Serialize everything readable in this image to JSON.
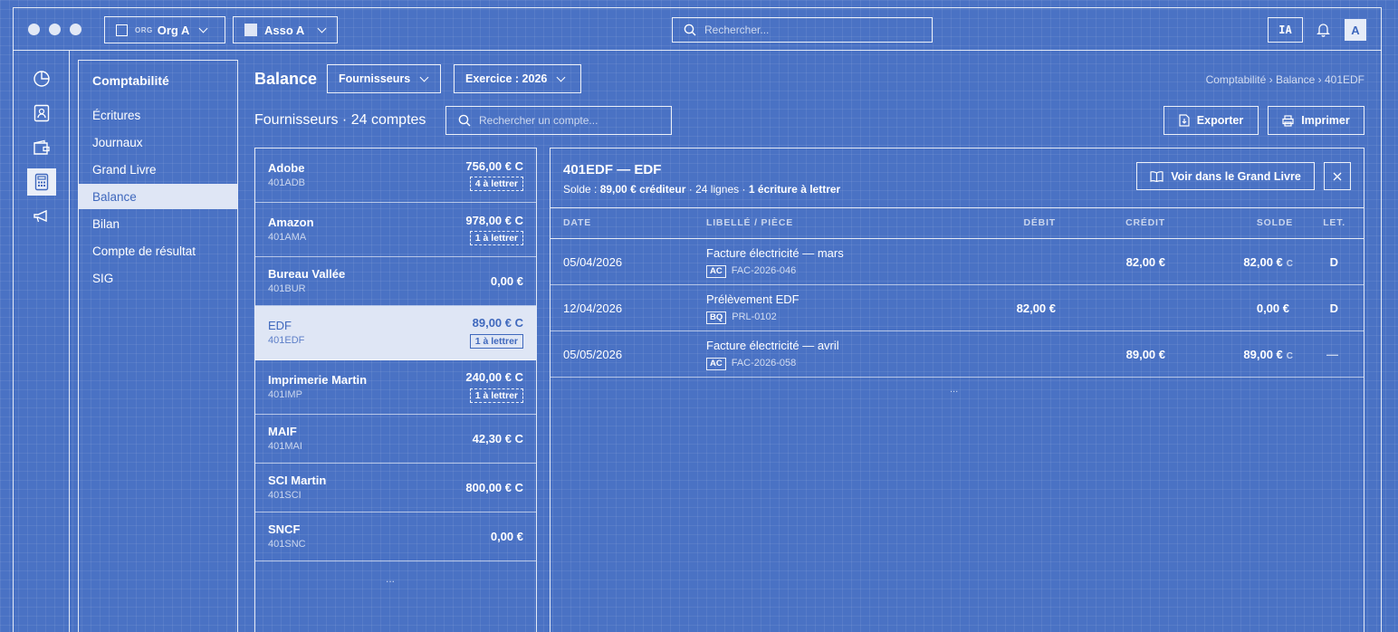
{
  "topbar": {
    "org_prefix": "ORG",
    "org_name": "Org A",
    "asso_name": "Asso A",
    "search_placeholder": "Rechercher...",
    "ai_label": "IA",
    "avatar_letter": "A"
  },
  "nav": {
    "title": "Comptabilité",
    "items": [
      "Écritures",
      "Journaux",
      "Grand Livre",
      "Balance",
      "Bilan",
      "Compte de résultat",
      "SIG"
    ]
  },
  "header": {
    "title": "Balance",
    "filter_type": "Fournisseurs",
    "filter_year": "Exercice : 2026",
    "breadcrumb": "Comptabilité › Balance › 401EDF",
    "subtitle": "Fournisseurs · 24 comptes",
    "account_search_placeholder": "Rechercher un compte...",
    "export_label": "Exporter",
    "print_label": "Imprimer"
  },
  "accounts": [
    {
      "name": "Adobe",
      "code": "401ADB",
      "amount": "756,00 € C",
      "badge": "4 à lettrer"
    },
    {
      "name": "Amazon",
      "code": "401AMA",
      "amount": "978,00 € C",
      "badge": "1 à lettrer"
    },
    {
      "name": "Bureau Vallée",
      "code": "401BUR",
      "amount": "0,00 €",
      "badge": ""
    },
    {
      "name": "EDF",
      "code": "401EDF",
      "amount": "89,00 € C",
      "badge": "1 à lettrer"
    },
    {
      "name": "Imprimerie Martin",
      "code": "401IMP",
      "amount": "240,00 € C",
      "badge": "1 à lettrer"
    },
    {
      "name": "MAIF",
      "code": "401MAI",
      "amount": "42,30 € C",
      "badge": ""
    },
    {
      "name": "SCI Martin",
      "code": "401SCI",
      "amount": "800,00 € C",
      "badge": ""
    },
    {
      "name": "SNCF",
      "code": "401SNC",
      "amount": "0,00 €",
      "badge": ""
    }
  ],
  "accounts_more": "...",
  "detail": {
    "title": "401EDF — EDF",
    "solde_label": "Solde :",
    "solde_value": "89,00 € créditeur",
    "lines": "· 24 lignes ·",
    "to_letter": "1 écriture à lettrer",
    "gl_button": "Voir dans le Grand Livre",
    "columns": {
      "date": "DATE",
      "label": "LIBELLÉ / PIÈCE",
      "debit": "DÉBIT",
      "credit": "CRÉDIT",
      "solde": "SOLDE",
      "let": "LET."
    },
    "rows": [
      {
        "date": "05/04/2026",
        "label": "Facture électricité — mars",
        "journal": "AC",
        "piece": "FAC-2026-046",
        "debit": "",
        "credit": "82,00 €",
        "solde": "82,00 €",
        "solde_sign": "C",
        "let": "D"
      },
      {
        "date": "12/04/2026",
        "label": "Prélèvement EDF",
        "journal": "BQ",
        "piece": "PRL-0102",
        "debit": "82,00 €",
        "credit": "",
        "solde": "0,00 €",
        "solde_sign": "",
        "let": "D"
      },
      {
        "date": "05/05/2026",
        "label": "Facture électricité — avril",
        "journal": "AC",
        "piece": "FAC-2026-058",
        "debit": "",
        "credit": "89,00 €",
        "solde": "89,00 €",
        "solde_sign": "C",
        "let": "—"
      }
    ],
    "more": "..."
  }
}
